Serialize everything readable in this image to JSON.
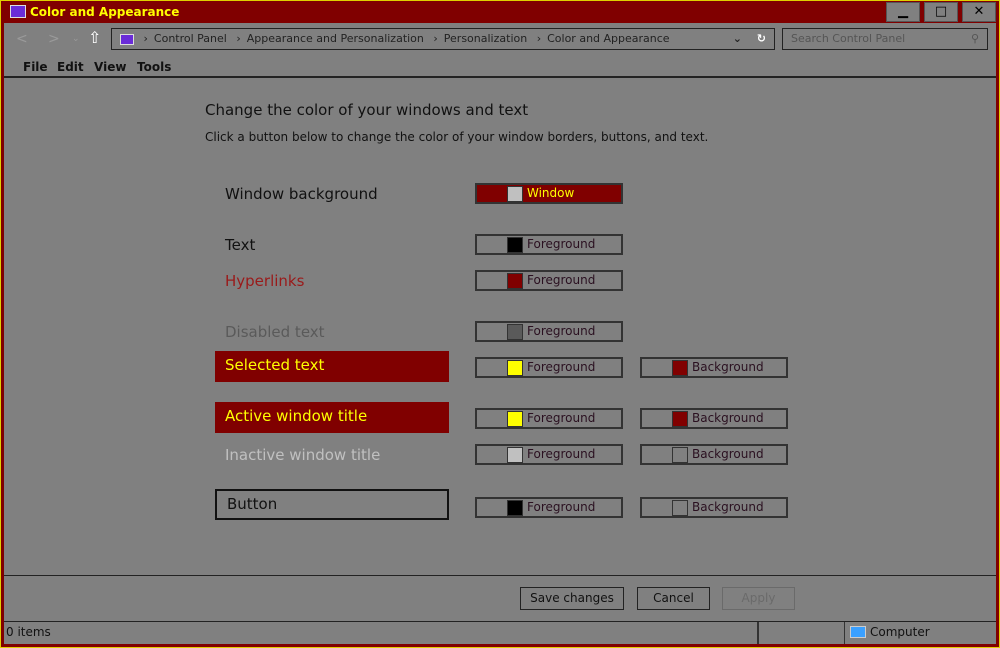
{
  "window": {
    "title": "Color and Appearance",
    "minimize": "▁",
    "maximize": "□",
    "close": "✕"
  },
  "address": {
    "crumbs": [
      "Control Panel",
      "Appearance and Personalization",
      "Personalization",
      "Color and Appearance"
    ],
    "search_placeholder": "Search Control Panel"
  },
  "menu": [
    "File",
    "Edit",
    "View",
    "Tools"
  ],
  "main": {
    "heading": "Change the color of your windows and text",
    "subheading": "Click a button below to change the color of your window borders, buttons, and text."
  },
  "items": [
    {
      "label": "Window background",
      "fg_label": "Window",
      "fg": "#c0c0c0"
    },
    {
      "label": "Text",
      "fg_label": "Foreground",
      "fg": "#000000"
    },
    {
      "label": "Hyperlinks",
      "fg_label": "Foreground",
      "fg": "#800000"
    },
    {
      "label": "Disabled text",
      "fg_label": "Foreground",
      "fg": "#5a5a5a"
    },
    {
      "label": "Selected text",
      "fg_label": "Foreground",
      "fg": "#ffff00",
      "bg_label": "Background",
      "bg": "#800000"
    },
    {
      "label": "Active window title",
      "fg_label": "Foreground",
      "fg": "#ffff00",
      "bg_label": "Background",
      "bg": "#800000"
    },
    {
      "label": "Inactive window title",
      "fg_label": "Foreground",
      "fg": "#c0c0c0",
      "bg_label": "Background",
      "bg": "#808080"
    },
    {
      "label": "Button",
      "fg_label": "Foreground",
      "fg": "#000000",
      "bg_label": "Background",
      "bg": "#808080"
    }
  ],
  "buttons": {
    "save": "Save changes",
    "cancel": "Cancel",
    "apply": "Apply"
  },
  "status": {
    "items": "0 items",
    "location": "Computer"
  }
}
